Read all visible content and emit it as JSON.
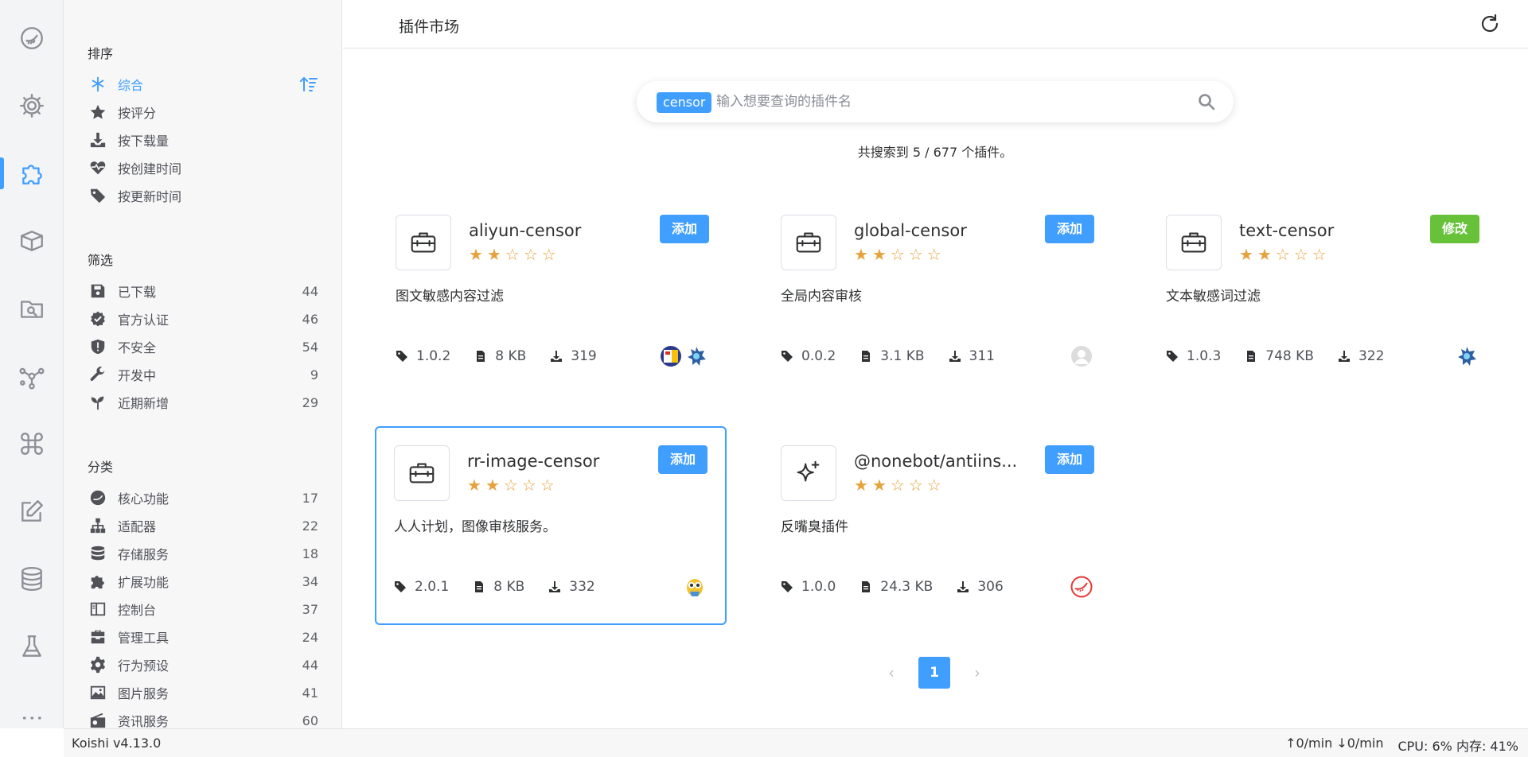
{
  "header": {
    "title": "插件市场"
  },
  "sidebar": {
    "sort_title": "排序",
    "sort_items": [
      {
        "label": "综合",
        "icon": "asterisk-icon"
      },
      {
        "label": "按评分",
        "icon": "star-icon"
      },
      {
        "label": "按下载量",
        "icon": "download-icon"
      },
      {
        "label": "按创建时间",
        "icon": "heart-pulse-icon"
      },
      {
        "label": "按更新时间",
        "icon": "tag-icon"
      }
    ],
    "filter_title": "筛选",
    "filter_items": [
      {
        "label": "已下载",
        "count": "44",
        "icon": "save-icon"
      },
      {
        "label": "官方认证",
        "count": "46",
        "icon": "verified-icon"
      },
      {
        "label": "不安全",
        "count": "54",
        "icon": "shield-alert-icon"
      },
      {
        "label": "开发中",
        "count": "9",
        "icon": "wrench-icon"
      },
      {
        "label": "近期新增",
        "count": "29",
        "icon": "seedling-icon"
      }
    ],
    "category_title": "分类",
    "category_items": [
      {
        "label": "核心功能",
        "count": "17",
        "icon": "koishi-icon"
      },
      {
        "label": "适配器",
        "count": "22",
        "icon": "network-icon"
      },
      {
        "label": "存储服务",
        "count": "18",
        "icon": "database-icon"
      },
      {
        "label": "扩展功能",
        "count": "34",
        "icon": "puzzle-icon"
      },
      {
        "label": "控制台",
        "count": "37",
        "icon": "layout-icon"
      },
      {
        "label": "管理工具",
        "count": "24",
        "icon": "toolbox-icon"
      },
      {
        "label": "行为预设",
        "count": "44",
        "icon": "gear-icon"
      },
      {
        "label": "图片服务",
        "count": "41",
        "icon": "image-icon"
      },
      {
        "label": "资讯服务",
        "count": "60",
        "icon": "radio-icon"
      }
    ]
  },
  "search": {
    "tag": "censor",
    "placeholder": "输入想要查询的插件名",
    "value": ""
  },
  "result_count": "共搜索到 5 / 677 个插件。",
  "cards": [
    {
      "name": "aliyun-censor",
      "action": "添加",
      "desc": "图文敏感内容过滤",
      "version": "1.0.2",
      "size": "8 KB",
      "downloads": "319",
      "rating": 2,
      "icon": "toolbox-icon"
    },
    {
      "name": "global-censor",
      "action": "添加",
      "desc": "全局内容审核",
      "version": "0.0.2",
      "size": "3.1 KB",
      "downloads": "311",
      "rating": 2,
      "icon": "toolbox-icon"
    },
    {
      "name": "text-censor",
      "action": "修改",
      "desc": "文本敏感词过滤",
      "version": "1.0.3",
      "size": "748 KB",
      "downloads": "322",
      "rating": 2,
      "icon": "toolbox-icon"
    },
    {
      "name": "rr-image-censor",
      "action": "添加",
      "desc": "人人计划，图像审核服务。",
      "version": "2.0.1",
      "size": "8 KB",
      "downloads": "332",
      "rating": 2,
      "icon": "toolbox-icon"
    },
    {
      "name": "@nonebot/antiins...",
      "action": "添加",
      "desc": "反嘴臭插件",
      "version": "1.0.0",
      "size": "24.3 KB",
      "downloads": "306",
      "rating": 2,
      "icon": "sparkles-icon"
    }
  ],
  "pagination": {
    "prev": "‹",
    "current": "1",
    "next": "›"
  },
  "status": {
    "version": "Koishi v4.13.0",
    "upload": "0/min",
    "download": "0/min",
    "cpu": "CPU: 6%",
    "memory": "内存: 41%"
  },
  "colors": {
    "accent": "#409eff",
    "edit": "#67c23a",
    "star": "#e6a23c"
  }
}
